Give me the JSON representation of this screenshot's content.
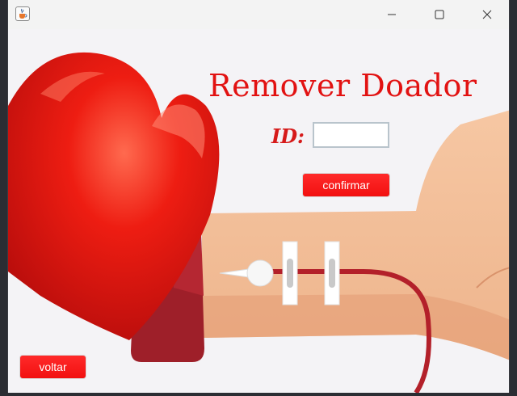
{
  "window": {
    "controls": {
      "app_icon": "java-cup-icon",
      "minimize": "minimize-icon",
      "maximize": "maximize-icon",
      "close": "close-icon"
    }
  },
  "form": {
    "title": "Remover Doador",
    "id_label": "ID:",
    "id_value": "",
    "confirm_label": "confirmar",
    "back_label": "voltar"
  },
  "illustration": {
    "subject": "heart-with-blood-donation-arm",
    "heart_color": "#e0140f",
    "skin_color": "#f3c09a",
    "tube_color": "#b3202a"
  },
  "colors": {
    "accent": "#f21010",
    "title": "#e21212"
  }
}
